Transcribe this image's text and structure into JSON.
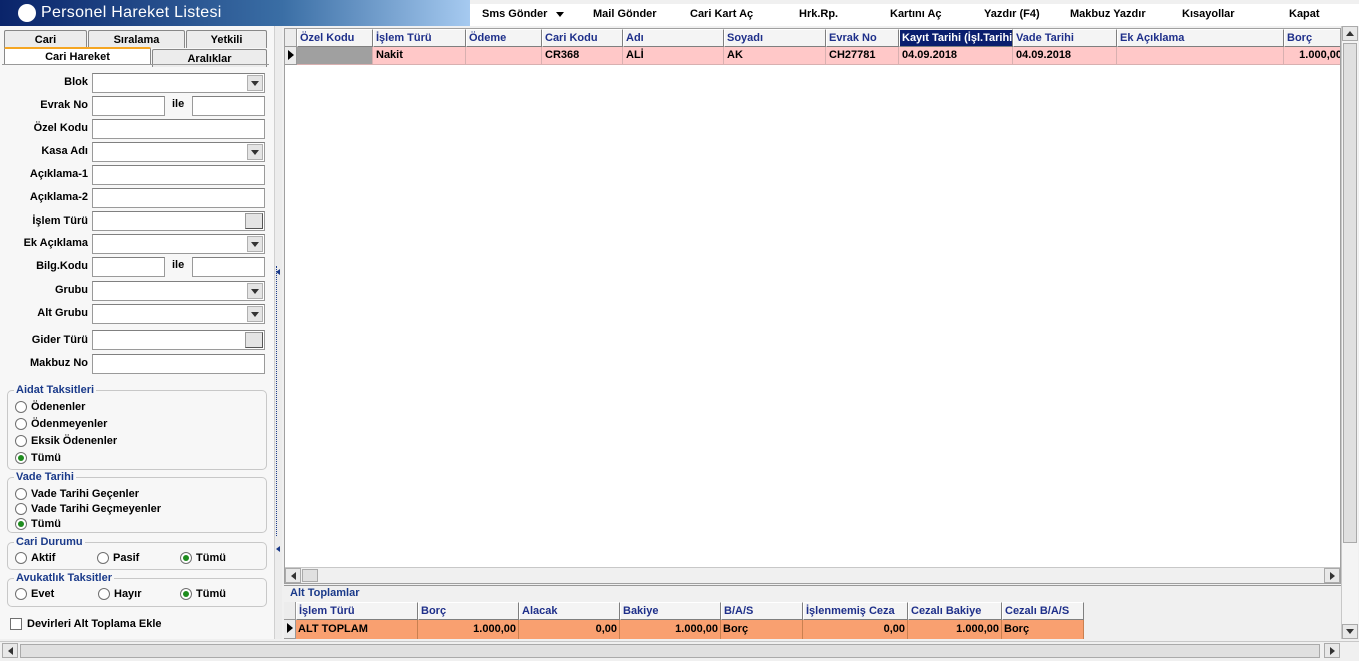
{
  "window": {
    "title": "Personel Hareket Listesi"
  },
  "toolbar": {
    "sms": "Sms Gönder",
    "mail": "Mail Gönder",
    "cari_kart": "Cari Kart Aç",
    "hrk_rp": "Hrk.Rp.",
    "kartini_ac": "Kartını Aç",
    "yazdir": "Yazdır (F4)",
    "makbuz": "Makbuz Yazdır",
    "kisayollar": "Kısayollar",
    "kapat": "Kapat"
  },
  "tabs": {
    "row1": [
      "Cari",
      "Sıralama",
      "Yetkili"
    ],
    "row2": [
      "Cari Hareket",
      "Aralıklar"
    ]
  },
  "filters": {
    "blok": "Blok",
    "evrak_no": "Evrak No",
    "ile": "ile",
    "ozel_kodu": "Özel Kodu",
    "kasa_adi": "Kasa Adı",
    "aciklama1": "Açıklama-1",
    "aciklama2": "Açıklama-2",
    "islem_turu": "İşlem Türü",
    "ek_aciklama": "Ek Açıklama",
    "bilg_kodu": "Bilg.Kodu",
    "grubu": "Grubu",
    "alt_grubu": "Alt Grubu",
    "gider_turu": "Gider Türü",
    "makbuz_no": "Makbuz No"
  },
  "groups": {
    "aidat": {
      "title": "Aidat Taksitleri",
      "options": [
        "Ödenenler",
        "Ödenmeyenler",
        "Eksik Ödenenler",
        "Tümü"
      ],
      "selected": 3
    },
    "vade": {
      "title": "Vade Tarihi",
      "options": [
        "Vade Tarihi Geçenler",
        "Vade Tarihi Geçmeyenler",
        "Tümü"
      ],
      "selected": 2
    },
    "cari_durumu": {
      "title": "Cari Durumu",
      "options": [
        "Aktif",
        "Pasif",
        "Tümü"
      ],
      "selected": 2
    },
    "avukatlik": {
      "title": "Avukatlık Taksitler",
      "options": [
        "Evet",
        "Hayır",
        "Tümü"
      ],
      "selected": 2
    }
  },
  "checkbox": {
    "devirleri": "Devirleri Alt Toplama Ekle",
    "checked": false
  },
  "grid": {
    "columns": [
      "Özel Kodu",
      "İşlem Türü",
      "Ödeme",
      "Cari Kodu",
      "Adı",
      "Soyadı",
      "Evrak No",
      "Kayıt Tarihi (İşl.Tarihi)",
      "Vade Tarihi",
      "Ek Açıklama",
      "Borç"
    ],
    "selected_column": 7,
    "rows": [
      [
        "",
        "Nakit",
        "",
        "CR368",
        "ALİ",
        "AK",
        "CH27781",
        "04.09.2018",
        "04.09.2018",
        "",
        "1.000,00"
      ]
    ],
    "row_color": "#ffc8c8",
    "first_cell_color": "#a0a0a0"
  },
  "subtotals": {
    "title": "Alt Toplamlar",
    "columns": [
      "İşlem Türü",
      "Borç",
      "Alacak",
      "Bakiye",
      "B/A/S",
      "İşlenmemiş Ceza",
      "Cezalı Bakiye",
      "Cezalı B/A/S"
    ],
    "row": [
      "ALT TOPLAM",
      "1.000,00",
      "0,00",
      "1.000,00",
      "Borç",
      "0,00",
      "1.000,00",
      "Borç"
    ],
    "row_color": "#f9a070"
  }
}
